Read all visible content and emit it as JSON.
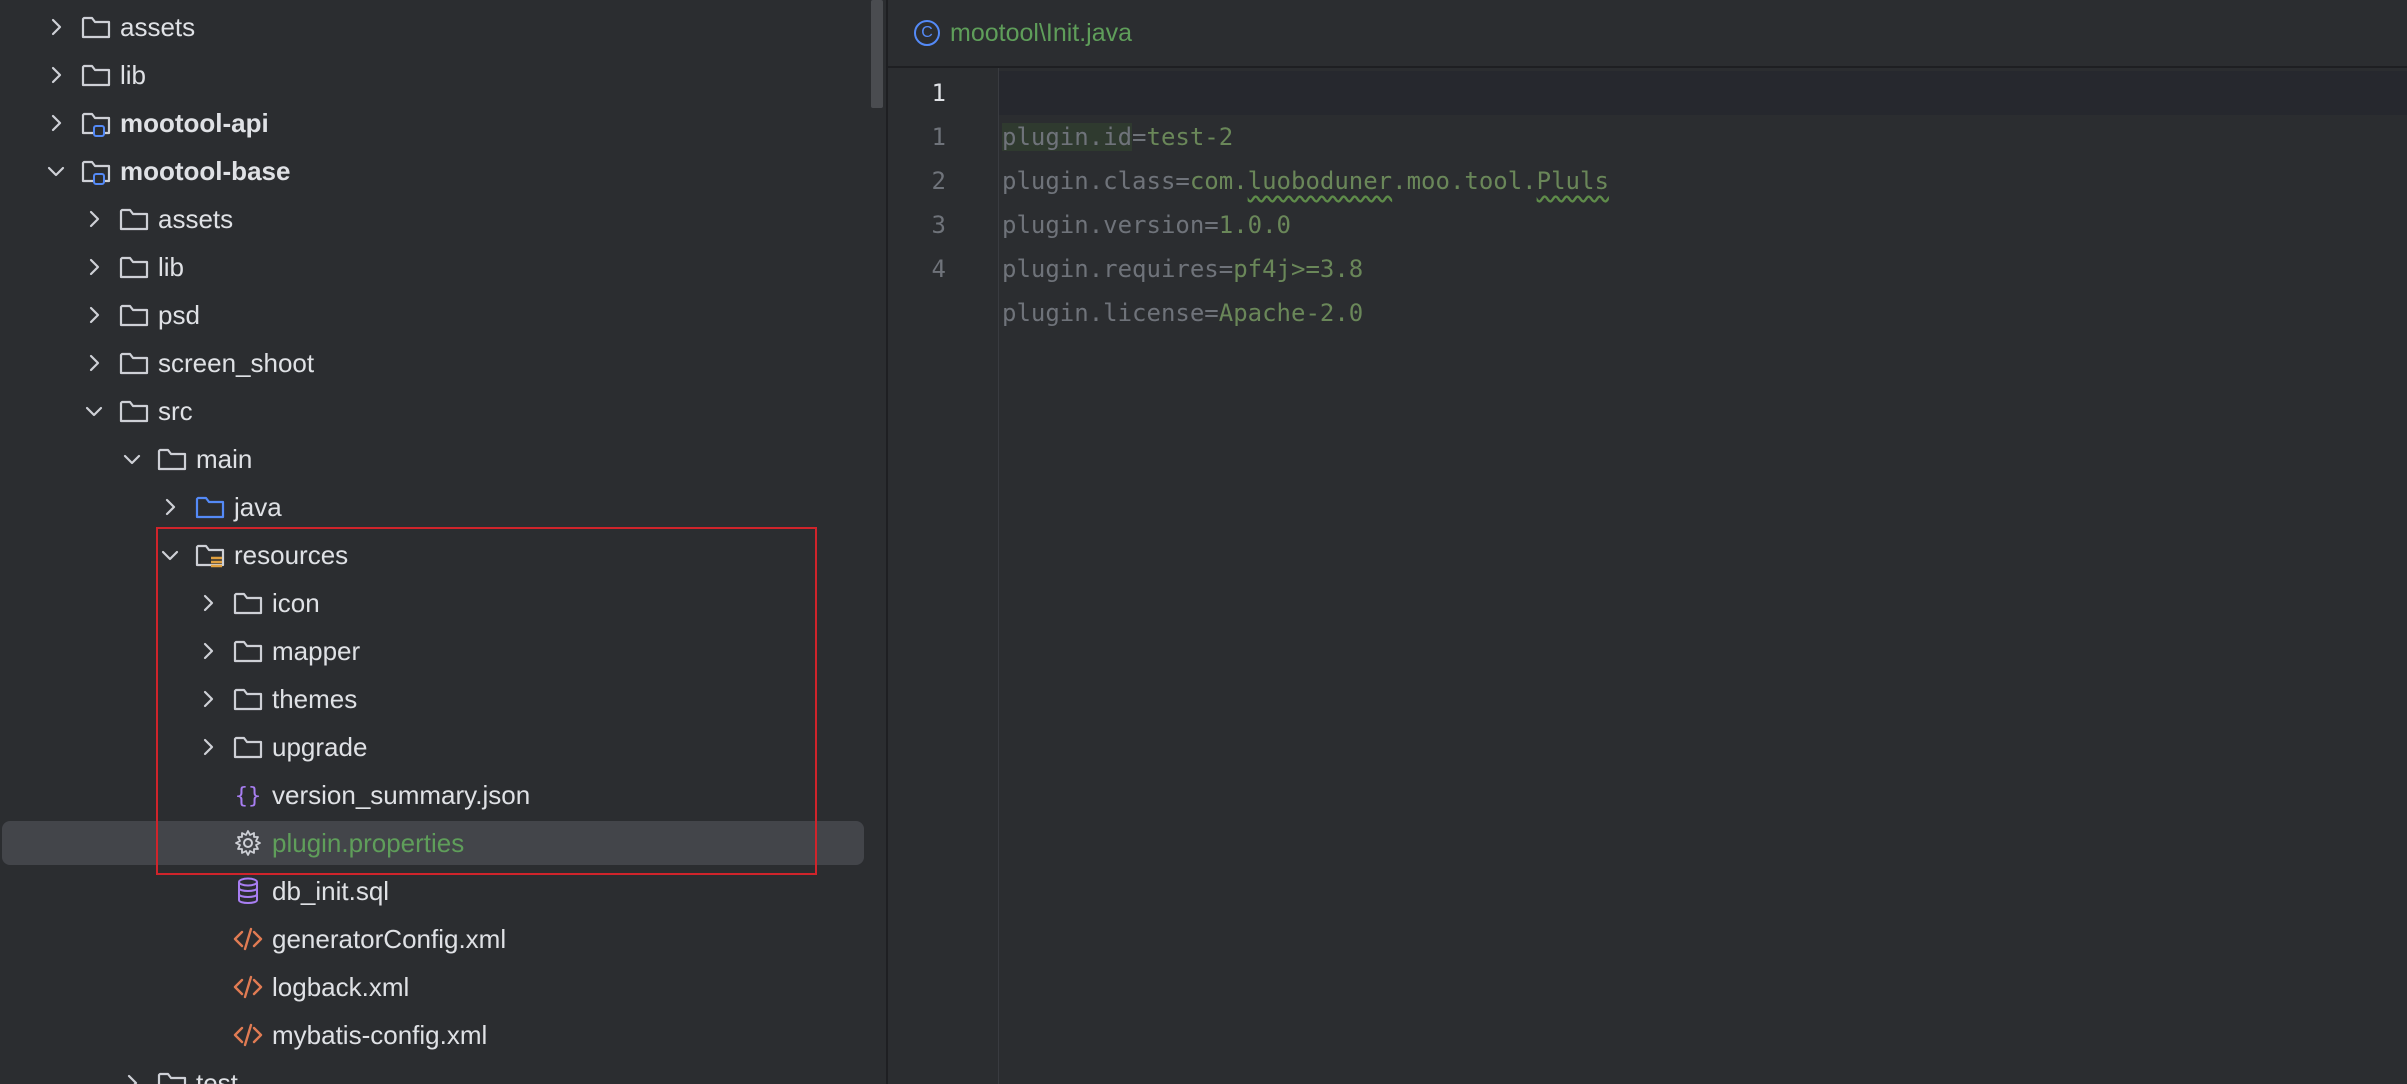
{
  "project_tree": {
    "items": [
      {
        "label": "assets",
        "expanded": false,
        "icon": "folder-icon"
      },
      {
        "label": "lib",
        "expanded": false,
        "icon": "folder-icon"
      },
      {
        "label": "mootool-api",
        "expanded": false,
        "icon": "module-folder-icon"
      },
      {
        "label": "mootool-base",
        "expanded": true,
        "icon": "module-folder-icon"
      },
      {
        "label": "assets",
        "expanded": false,
        "icon": "folder-icon"
      },
      {
        "label": "lib",
        "expanded": false,
        "icon": "folder-icon"
      },
      {
        "label": "psd",
        "expanded": false,
        "icon": "folder-icon"
      },
      {
        "label": "screen_shoot",
        "expanded": false,
        "icon": "folder-icon"
      },
      {
        "label": "src",
        "expanded": true,
        "icon": "folder-icon"
      },
      {
        "label": "main",
        "expanded": true,
        "icon": "folder-icon"
      },
      {
        "label": "java",
        "expanded": false,
        "icon": "source-folder-icon"
      },
      {
        "label": "resources",
        "expanded": true,
        "icon": "resources-folder-icon"
      },
      {
        "label": "icon",
        "expanded": false,
        "icon": "folder-icon"
      },
      {
        "label": "mapper",
        "expanded": false,
        "icon": "folder-icon"
      },
      {
        "label": "themes",
        "expanded": false,
        "icon": "folder-icon"
      },
      {
        "label": "upgrade",
        "expanded": false,
        "icon": "folder-icon"
      },
      {
        "label": "version_summary.json",
        "icon": "json-file-icon"
      },
      {
        "label": "plugin.properties",
        "icon": "properties-file-icon",
        "selected": true
      },
      {
        "label": "db_init.sql",
        "icon": "database-file-icon"
      },
      {
        "label": "generatorConfig.xml",
        "icon": "xml-file-icon"
      },
      {
        "label": "logback.xml",
        "icon": "xml-file-icon"
      },
      {
        "label": "mybatis-config.xml",
        "icon": "xml-file-icon"
      },
      {
        "label": "test",
        "expanded": false,
        "icon": "folder-icon"
      }
    ]
  },
  "editor": {
    "tab_title": "mootool\\Init.java",
    "tab_icon": "class-icon",
    "tab_icon_letter": "C",
    "line_numbers": [
      "1",
      "1",
      "2",
      "3",
      "4"
    ],
    "lines": [
      {
        "key": "plugin.id",
        "eq": "=",
        "value": "test-2"
      },
      {
        "key": "plugin.class",
        "eq": "=",
        "value_parts": [
          "com.",
          "luoboduner",
          ".moo.tool.",
          "Pluls"
        ]
      },
      {
        "key": "plugin.version",
        "eq": "=",
        "value": "1.0.0"
      },
      {
        "key": "plugin.requires",
        "eq": "=",
        "value": "pf4j>=3.8"
      },
      {
        "key": "plugin.license",
        "eq": "=",
        "value": "Apache-2.0"
      }
    ]
  },
  "colors": {
    "selected_text": "#5f9e5a",
    "highlight_border": "#d0242b",
    "value_green": "#6a8759"
  }
}
